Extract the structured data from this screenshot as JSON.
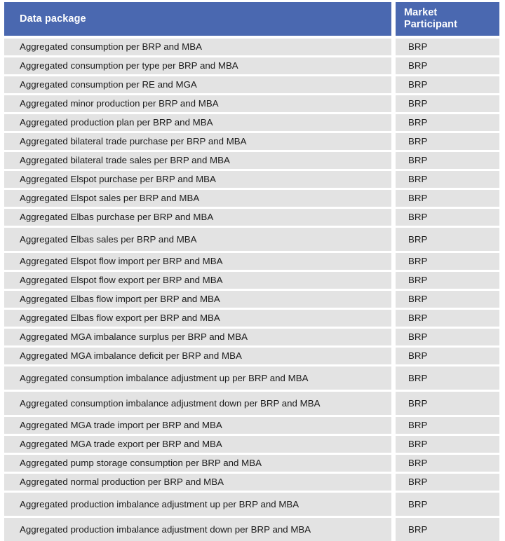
{
  "table": {
    "columns": [
      {
        "key": "package",
        "label": "Data package"
      },
      {
        "key": "market",
        "label": "Market\nParticipant"
      }
    ],
    "header": {
      "package_label": "Data package",
      "market_label_line1": "Market",
      "market_label_line2": "Participant"
    },
    "colors": {
      "header_background": "#4a68b0",
      "header_text": "#ffffff",
      "cell_background": "#e3e3e3",
      "cell_text": "#1b1b1b",
      "separator": "#ffffff",
      "page_background": "#ffffff"
    },
    "row_count": 23,
    "rows": [
      {
        "package": "Aggregated consumption per BRP and MBA",
        "market": "BRP",
        "height": "normal"
      },
      {
        "package": "Aggregated consumption per type per BRP and MBA",
        "market": "BRP",
        "height": "normal"
      },
      {
        "package": "Aggregated consumption per RE and MGA",
        "market": "BRP",
        "height": "normal"
      },
      {
        "package": "Aggregated minor production per BRP and MBA",
        "market": "BRP",
        "height": "normal"
      },
      {
        "package": "Aggregated production plan per BRP and MBA",
        "market": "BRP",
        "height": "normal"
      },
      {
        "package": "Aggregated bilateral trade purchase per BRP and MBA",
        "market": "BRP",
        "height": "normal"
      },
      {
        "package": "Aggregated bilateral trade sales per BRP and MBA",
        "market": "BRP",
        "height": "normal"
      },
      {
        "package": "Aggregated Elspot purchase per BRP and MBA",
        "market": "BRP",
        "height": "normal"
      },
      {
        "package": "Aggregated Elspot sales per BRP and MBA",
        "market": "BRP",
        "height": "normal"
      },
      {
        "package": "Aggregated Elbas purchase per BRP and MBA",
        "market": "BRP",
        "height": "normal"
      },
      {
        "package": "Aggregated Elbas sales per BRP and MBA",
        "market": "BRP",
        "height": "tall"
      },
      {
        "package": "Aggregated Elspot flow import per BRP and MBA",
        "market": "BRP",
        "height": "normal"
      },
      {
        "package": "Aggregated Elspot flow export per BRP and MBA",
        "market": "BRP",
        "height": "normal"
      },
      {
        "package": "Aggregated Elbas flow import per BRP and MBA",
        "market": "BRP",
        "height": "normal"
      },
      {
        "package": "Aggregated Elbas flow export per BRP and MBA",
        "market": "BRP",
        "height": "normal"
      },
      {
        "package": "Aggregated MGA imbalance surplus per BRP and MBA",
        "market": "BRP",
        "height": "normal"
      },
      {
        "package": "Aggregated MGA imbalance deficit per BRP and MBA",
        "market": "BRP",
        "height": "normal"
      },
      {
        "package": "Aggregated consumption imbalance adjustment up per BRP and MBA",
        "market": "BRP",
        "height": "tall"
      },
      {
        "package": "Aggregated consumption imbalance adjustment down per BRP and MBA",
        "market": "BRP",
        "height": "tall"
      },
      {
        "package": "Aggregated MGA trade import per BRP and MBA",
        "market": "BRP",
        "height": "normal"
      },
      {
        "package": "Aggregated MGA trade export per BRP and MBA",
        "market": "BRP",
        "height": "normal"
      },
      {
        "package": "Aggregated pump storage consumption per BRP and MBA",
        "market": "BRP",
        "height": "normal"
      },
      {
        "package": "Aggregated normal production per BRP and MBA",
        "market": "BRP",
        "height": "normal"
      },
      {
        "package": "Aggregated production imbalance adjustment up per BRP and MBA",
        "market": "BRP",
        "height": "tall"
      },
      {
        "package": "Aggregated production imbalance adjustment down per BRP and MBA",
        "market": "BRP",
        "height": "tall"
      }
    ]
  }
}
